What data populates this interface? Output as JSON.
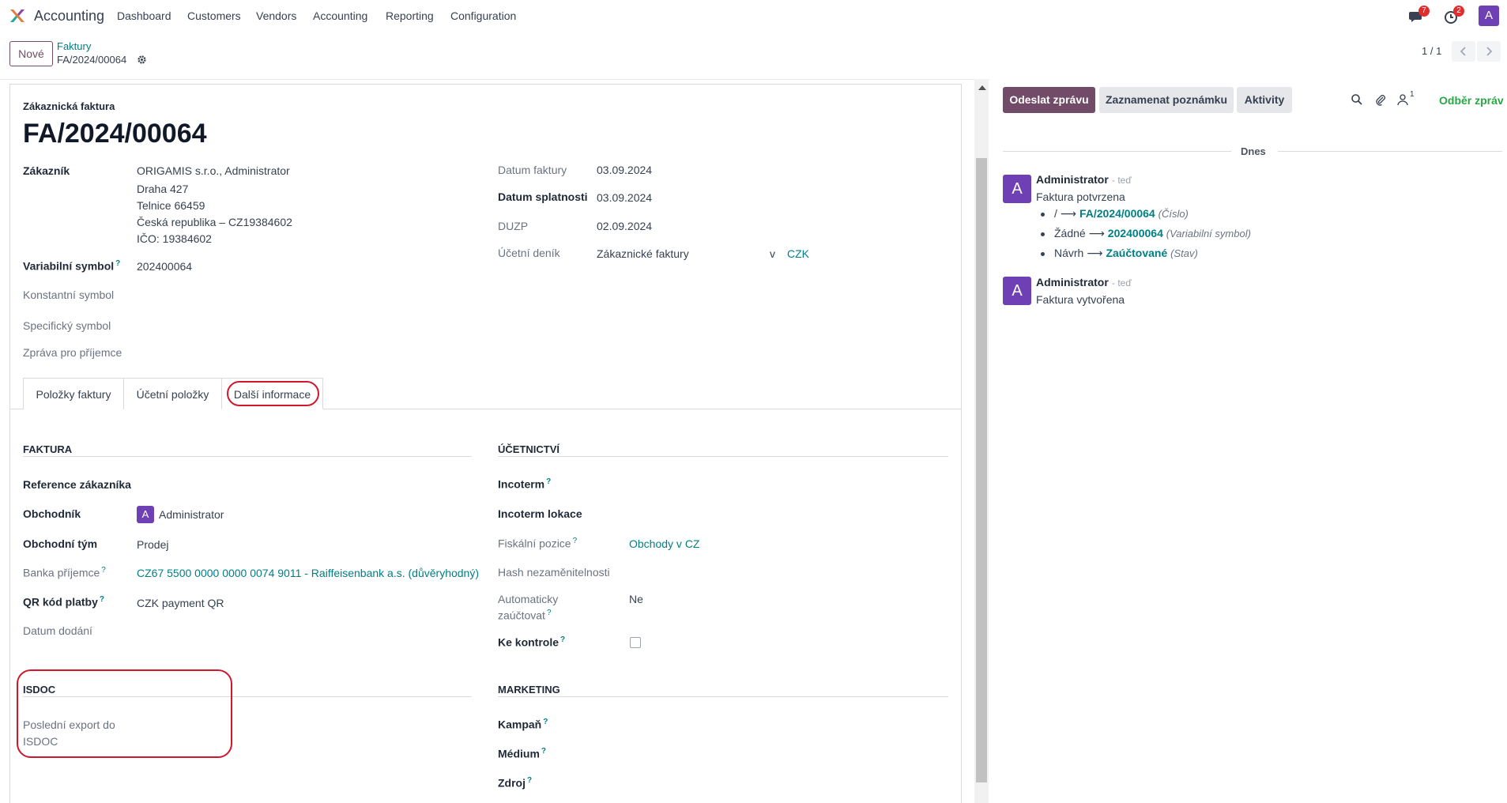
{
  "navbar": {
    "app_name": "Accounting",
    "menu": [
      "Dashboard",
      "Customers",
      "Vendors",
      "Accounting",
      "Reporting",
      "Configuration"
    ],
    "messages_count": "7",
    "activities_count": "2",
    "user_initial": "A"
  },
  "control": {
    "new_label": "Nové",
    "breadcrumb": "Faktury",
    "record": "FA/2024/00064",
    "pager": "1 / 1"
  },
  "form": {
    "doc_type": "Zákaznická faktura",
    "number": "FA/2024/00064",
    "customer_label": "Zákazník",
    "customer_lines": [
      "ORIGAMIS s.r.o., Administrator",
      "Draha 427",
      "Telnice 66459",
      "Česká republika – CZ19384602",
      "IČO: 19384602"
    ],
    "var_symbol_label": "Variabilní symbol",
    "var_symbol": "202400064",
    "const_symbol_label": "Konstantní symbol",
    "spec_symbol_label": "Specifický symbol",
    "message_label": "Zpráva pro příjemce",
    "invoice_date_label": "Datum faktury",
    "invoice_date": "03.09.2024",
    "due_date_label": "Datum splatnosti",
    "due_date": "03.09.2024",
    "duzp_label": "DUZP",
    "duzp": "02.09.2024",
    "journal_label": "Účetní deník",
    "journal": "Zákaznické faktury",
    "journal_in": "v",
    "currency": "CZK"
  },
  "tabs": [
    "Položky faktury",
    "Účetní položky",
    "Další informace"
  ],
  "faktura": {
    "title": "FAKTURA",
    "ref_label": "Reference zákazníka",
    "salesperson_label": "Obchodník",
    "salesperson": "Administrator",
    "salesperson_initial": "A",
    "team_label": "Obchodní tým",
    "team": "Prodej",
    "bank_label": "Banka příjemce",
    "bank": "CZ67 5500 0000 0000 0074 9011 - Raiffeisenbank a.s. (důvěryhodný)",
    "qr_label": "QR kód platby",
    "qr": "CZK payment QR",
    "delivery_label": "Datum dodání"
  },
  "ucetnictvi": {
    "title": "ÚČETNICTVÍ",
    "incoterm_label": "Incoterm",
    "incoterm_loc_label": "Incoterm lokace",
    "fiscal_label": "Fiskální pozice",
    "fiscal": "Obchody v CZ",
    "hash_label": "Hash nezaměnitelnosti",
    "auto_label_1": "Automaticky",
    "auto_label_2": "zaúčtovat",
    "auto": "Ne",
    "review_label": "Ke kontrole"
  },
  "isdoc": {
    "title": "ISDOC",
    "last_export_1": "Poslední export do",
    "last_export_2": "ISDOC"
  },
  "marketing": {
    "title": "MARKETING",
    "campaign_label": "Kampaň",
    "medium_label": "Médium",
    "source_label": "Zdroj"
  },
  "chatter": {
    "send_label": "Odeslat zprávu",
    "note_label": "Zaznamenat poznámku",
    "activities_label": "Aktivity",
    "followers_count": "1",
    "follow_label": "Odběr zpráv",
    "day_label": "Dnes",
    "messages": [
      {
        "initial": "A",
        "author": "Administrator",
        "time": "- teď",
        "text": "Faktura potvrzena",
        "changes": [
          {
            "old": "/",
            "new": "FA/2024/00064",
            "field": "(Číslo)"
          },
          {
            "old": "Žádné",
            "new": "202400064",
            "field": "(Variabilní symbol)"
          },
          {
            "old": "Návrh",
            "new": "Zaúčtované",
            "field": "(Stav)"
          }
        ]
      },
      {
        "initial": "A",
        "author": "Administrator",
        "time": "- teď",
        "text": "Faktura vytvořena"
      }
    ]
  },
  "colors": {
    "primary": "#714b67",
    "link": "#017e84",
    "avatar": "#6f3fb5",
    "highlight": "#d0172b",
    "follow": "#28a745"
  }
}
